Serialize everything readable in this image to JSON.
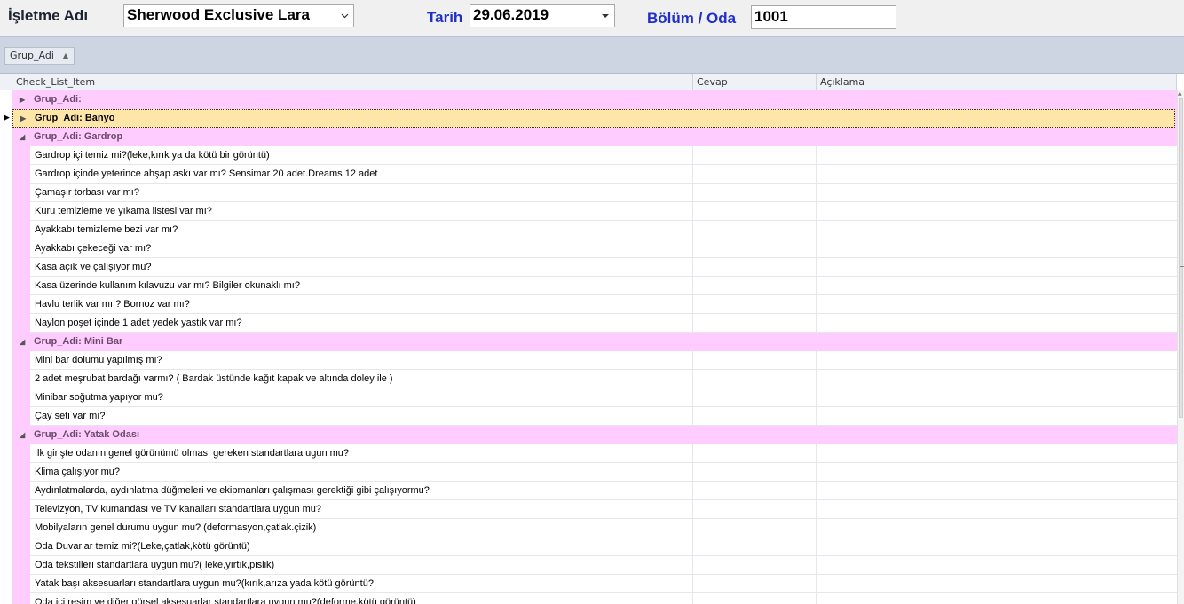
{
  "header": {
    "isletme_label": "İşletme Adı",
    "isletme_value": "Sherwood Exclusive Lara",
    "tarih_label": "Tarih",
    "tarih_value": "29.06.2019",
    "bolum_label": "Bölüm / Oda",
    "oda_value": "1001"
  },
  "group_panel": {
    "chip_label": "Grup_Adi"
  },
  "columns": {
    "item": "Check_List_Item",
    "cevap": "Cevap",
    "aciklama": "Açıklama"
  },
  "rows": [
    {
      "type": "group",
      "text": "Grup_Adi:",
      "expanded": false
    },
    {
      "type": "group",
      "text": "Grup_Adi: Banyo",
      "expanded": false,
      "focused": true
    },
    {
      "type": "group",
      "text": "Grup_Adi: Gardrop",
      "expanded": true
    },
    {
      "type": "item",
      "text": "Gardrop içi temiz mi?(leke,kırık ya da kötü bir görüntü)"
    },
    {
      "type": "item",
      "text": "Gardrop içinde yeterince ahşap askı var mı? Sensimar  20 adet.Dreams 12 adet"
    },
    {
      "type": "item",
      "text": "Çamaşır torbası var mı?"
    },
    {
      "type": "item",
      "text": "Kuru temizleme ve yıkama listesi var mı?"
    },
    {
      "type": "item",
      "text": "Ayakkabı temizleme bezi var mı?"
    },
    {
      "type": "item",
      "text": "Ayakkabı çekeceği var mı?"
    },
    {
      "type": "item",
      "text": "Kasa açık ve çalışıyor mu?"
    },
    {
      "type": "item",
      "text": "Kasa üzerinde kullanım kılavuzu var mı? Bilgiler okunaklı mı?"
    },
    {
      "type": "item",
      "text": "Havlu terlik var mı ? Bornoz var mı?"
    },
    {
      "type": "item",
      "text": "Naylon poşet içinde 1 adet yedek yastık var mı?"
    },
    {
      "type": "group",
      "text": "Grup_Adi: Mini Bar",
      "expanded": true
    },
    {
      "type": "item",
      "text": "Mini bar dolumu yapılmış mı?"
    },
    {
      "type": "item",
      "text": "2 adet meşrubat bardağı varmı? ( Bardak üstünde kağıt kapak ve altında doley ile )"
    },
    {
      "type": "item",
      "text": "Minibar soğutma yapıyor mu?"
    },
    {
      "type": "item",
      "text": "Çay seti var mı?"
    },
    {
      "type": "group",
      "text": "Grup_Adi: Yatak Odası",
      "expanded": true
    },
    {
      "type": "item",
      "text": "İlk girişte odanın genel görünümü olması gereken standartlara ugun mu?"
    },
    {
      "type": "item",
      "text": "Klima çalışıyor mu?"
    },
    {
      "type": "item",
      "text": "Aydınlatmalarda, aydınlatma düğmeleri ve ekipmanları çalışması gerektiği gibi çalışıyormu?"
    },
    {
      "type": "item",
      "text": "Televizyon, TV kumandası ve TV kanalları standartlara uygun mu?"
    },
    {
      "type": "item",
      "text": "Mobilyaların genel durumu uygun mu? (deformasyon,çatlak.çizik)"
    },
    {
      "type": "item",
      "text": "Oda Duvarlar  temiz mi?(Leke,çatlak,kötü görüntü)"
    },
    {
      "type": "item",
      "text": "Oda tekstilleri standartlara uygun mu?( leke,yırtık,pislik)"
    },
    {
      "type": "item",
      "text": "Yatak başı aksesuarları  standartlara uygun mu?(kırık,arıza yada kötü görüntü?"
    },
    {
      "type": "item",
      "text": "Oda içi resim ve diğer görsel aksesuarlar standartlara uygun mu?(deforme,kötü görüntü)"
    }
  ],
  "colors": {
    "group_row": "#ffccff",
    "focused_row": "#fde6a8",
    "label_blue": "#1f2fc8"
  }
}
